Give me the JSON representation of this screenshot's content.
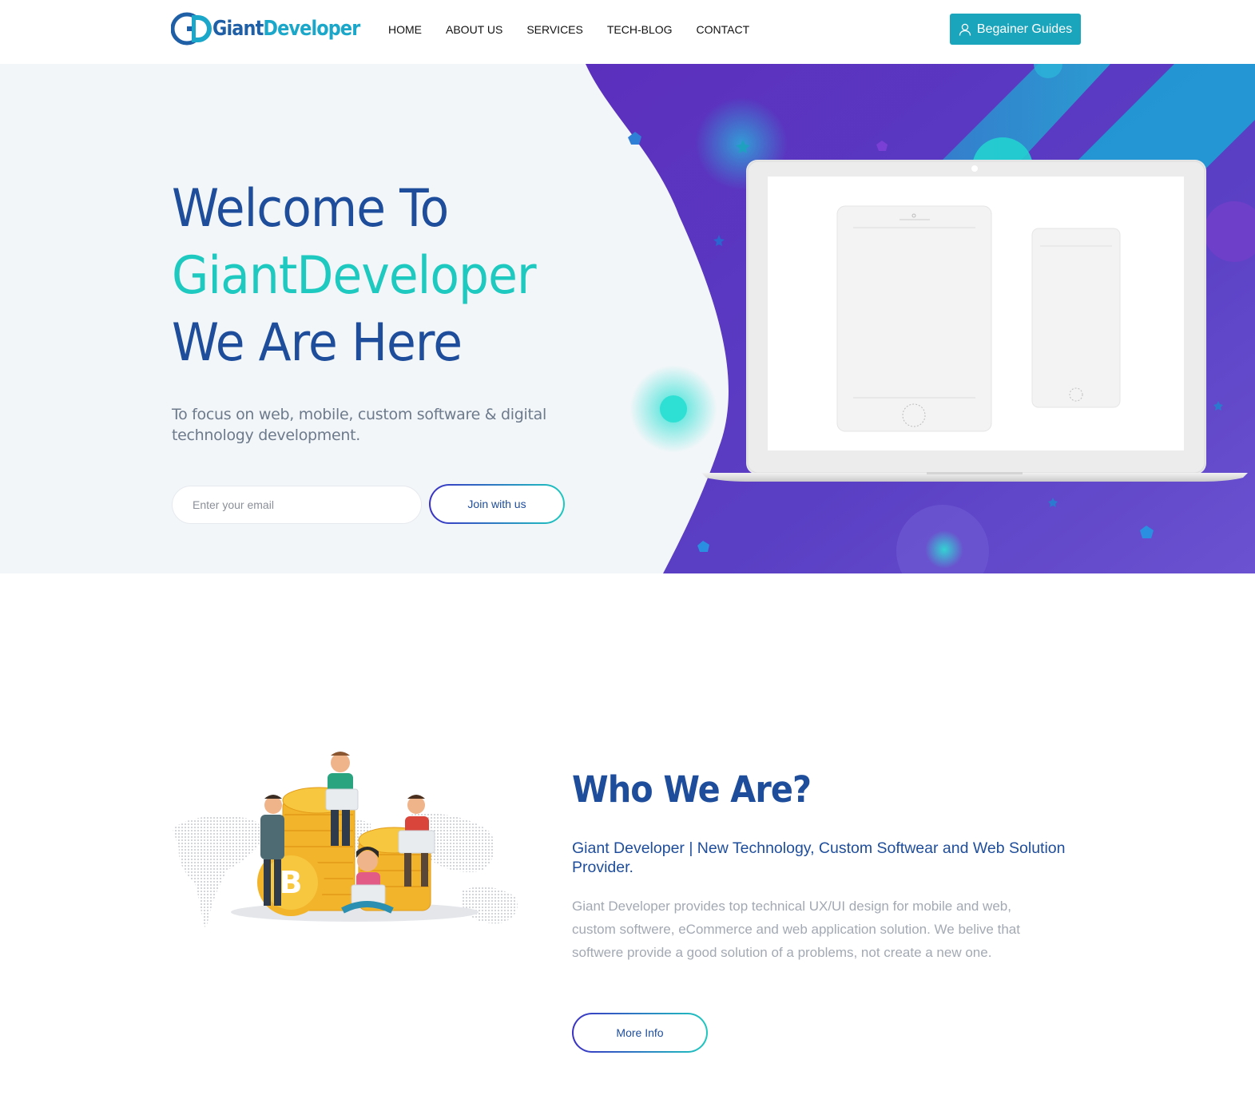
{
  "header": {
    "logo_mark": "GD",
    "logo_word1": "Giant",
    "logo_word2": "Developer",
    "nav": [
      "HOME",
      "ABOUT US",
      "SERVICES",
      "TECH-BLOG",
      "CONTACT"
    ],
    "cta_label": "Begainer Guides",
    "cta_icon": "user-icon"
  },
  "hero": {
    "title_line1": "Welcome To",
    "title_line2": "GiantDeveloper",
    "title_line3": "We Are Here",
    "subtitle": "To focus on web, mobile, custom software & digital technology development.",
    "email_placeholder": "Enter your email",
    "join_label": "Join with us"
  },
  "about": {
    "title": "Who We Are?",
    "subtitle": "Giant Developer | New Technology, Custom Softwear and Web Solution Provider.",
    "text": "Giant Developer provides top technical UX/UI design for mobile and web, custom softwere, eCommerce and web application solution. We belive that softwere provide a good solution of a problems, not create a new one.",
    "more_label": "More Info"
  },
  "colors": {
    "brand_blue": "#1e4d9b",
    "brand_teal": "#1ec9c0",
    "cta_bg": "#1aa5bc",
    "hero_purple": "#5a37c2"
  }
}
